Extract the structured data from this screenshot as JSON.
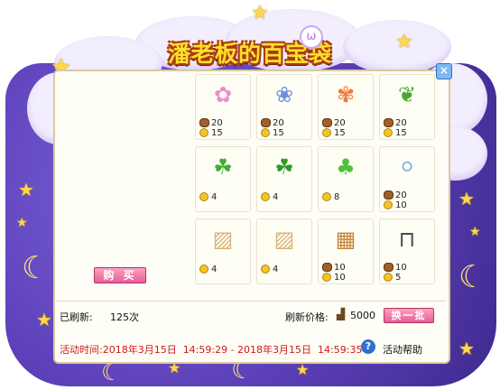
{
  "window": {
    "title": "潘老板的百宝袋",
    "close_symbol": "×",
    "bunny_symbol": "ω"
  },
  "preview": {
    "buy_label": "购 买"
  },
  "items": [
    {
      "icon": "pink-flower-icon",
      "glyph": "✿",
      "color": "#f08ad6",
      "bean": "20",
      "coin": "15"
    },
    {
      "icon": "blue-flower-icon",
      "glyph": "❀",
      "color": "#6e8fe0",
      "bean": "20",
      "coin": "15"
    },
    {
      "icon": "orange-flower-icon",
      "glyph": "✾",
      "color": "#f07a3a",
      "bean": "20",
      "coin": "15"
    },
    {
      "icon": "sprout-icon",
      "glyph": "❦",
      "color": "#4aa832",
      "bean": "20",
      "coin": "15"
    },
    {
      "icon": "hanging-vine-pink-icon",
      "glyph": "☘",
      "color": "#3fae2f",
      "bean": null,
      "coin": "4"
    },
    {
      "icon": "hanging-vine-envelope-icon",
      "glyph": "☘",
      "color": "#2f9a2a",
      "bean": null,
      "coin": "4"
    },
    {
      "icon": "green-topiary-icon",
      "glyph": "♣",
      "color": "#4cc03a",
      "bean": null,
      "coin": "8"
    },
    {
      "icon": "bubble-lamp-icon",
      "glyph": "⚪",
      "color": "#7fb6ea",
      "bean": "20",
      "coin": "10"
    },
    {
      "icon": "wood-wall-panel-icon",
      "glyph": "▨",
      "color": "#d9b27a",
      "bean": null,
      "coin": "4"
    },
    {
      "icon": "wood-wall-panel-icon",
      "glyph": "▨",
      "color": "#d9b27a",
      "bean": null,
      "coin": "4"
    },
    {
      "icon": "wooden-cabinet-icon",
      "glyph": "▦",
      "color": "#c4823a",
      "bean": "10",
      "coin": "10"
    },
    {
      "icon": "dark-bench-icon",
      "glyph": "⊓",
      "color": "#4a4a52",
      "bean": "10",
      "coin": "5"
    }
  ],
  "status": {
    "refreshed_label": "已刷新:",
    "refreshed_count": "125次",
    "refresh_price_label": "刷新价格:",
    "refresh_price_value": "5000",
    "refresh_button": "换一批",
    "activity_time": "活动时间:2018年3月15日  14:59:29 - 2018年3月15日  14:59:35",
    "help_label": "活动帮助",
    "help_symbol": "?"
  },
  "colors": {
    "accent": "#e65f94",
    "bag": "#5b3fb8",
    "title": "#ffde2a",
    "time_text": "#cc1a1a"
  }
}
